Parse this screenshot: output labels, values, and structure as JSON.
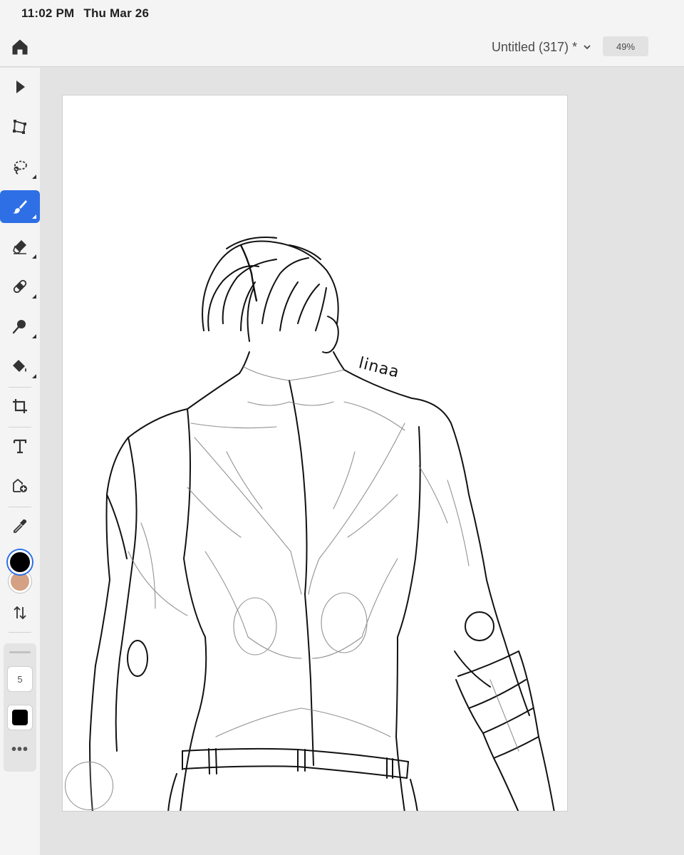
{
  "status": {
    "time": "11:02 PM",
    "date": "Thu Mar 26"
  },
  "header": {
    "document_title": "Untitled (317) *",
    "zoom": "49%",
    "title_icon": "chevron-down-icon"
  },
  "toolbar": {
    "tools": [
      {
        "name": "select-tool",
        "icon": "arrow-pointer-icon"
      },
      {
        "name": "transform-tool",
        "icon": "transform-icon"
      },
      {
        "name": "lasso-tool",
        "icon": "lasso-icon"
      },
      {
        "name": "brush-tool",
        "icon": "brush-icon",
        "active": true
      },
      {
        "name": "eraser-tool",
        "icon": "eraser-icon"
      },
      {
        "name": "healing-tool",
        "icon": "bandage-icon"
      },
      {
        "name": "smudge-tool",
        "icon": "smudge-icon"
      },
      {
        "name": "fill-tool",
        "icon": "paint-bucket-icon"
      },
      {
        "name": "crop-tool",
        "icon": "crop-icon"
      },
      {
        "name": "text-tool",
        "icon": "text-icon"
      },
      {
        "name": "place-image-tool",
        "icon": "place-image-icon"
      },
      {
        "name": "eyedropper-tool",
        "icon": "eyedropper-icon"
      }
    ],
    "colors": {
      "foreground": "#000000",
      "background": "#d4a184"
    },
    "brush_size": "5",
    "accent": "#2e6fe6"
  },
  "canvas": {
    "signature": "linaa"
  }
}
